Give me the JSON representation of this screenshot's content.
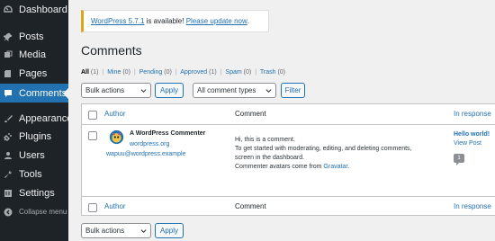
{
  "sidebar": {
    "items": [
      {
        "label": "Dashboard",
        "icon": "dashboard-icon"
      },
      {
        "label": "Posts",
        "icon": "pin-icon"
      },
      {
        "label": "Media",
        "icon": "media-icon"
      },
      {
        "label": "Pages",
        "icon": "pages-icon"
      },
      {
        "label": "Comments",
        "icon": "comment-icon",
        "current": true
      },
      {
        "label": "Appearance",
        "icon": "brush-icon"
      },
      {
        "label": "Plugins",
        "icon": "plug-icon"
      },
      {
        "label": "Users",
        "icon": "user-icon"
      },
      {
        "label": "Tools",
        "icon": "wrench-icon"
      },
      {
        "label": "Settings",
        "icon": "settings-icon"
      },
      {
        "label": "Collapse menu",
        "icon": "collapse-icon"
      }
    ]
  },
  "notice": {
    "version_link": "WordPress 5.7.1",
    "middle": " is available! ",
    "update_link": "Please update now",
    "end": "."
  },
  "page_title": "Comments",
  "filters": {
    "all": "All",
    "all_count": "(1)",
    "mine": "Mine",
    "mine_count": "(0)",
    "pending": "Pending",
    "pending_count": "(0)",
    "approved": "Approved",
    "approved_count": "(1)",
    "spam": "Spam",
    "spam_count": "(0)",
    "trash": "Trash",
    "trash_count": "(0)",
    "separator": "|"
  },
  "toolbar": {
    "bulk_actions": "Bulk actions",
    "apply": "Apply",
    "comment_types": "All comment types",
    "filter": "Filter"
  },
  "table": {
    "headers": {
      "author": "Author",
      "comment": "Comment",
      "in_response": "In response"
    },
    "row": {
      "author_name": "A WordPress Commenter",
      "author_site": "wordpress.org",
      "author_email": "wapuu@wordpress.example",
      "comment_line1": "Hi, this is a comment.",
      "comment_line2": "To get started with moderating, editing, and deleting comments,",
      "comment_line3": "screen in the dashboard.",
      "comment_line4_pre": "Commenter avatars come from ",
      "comment_line4_link": "Gravatar",
      "comment_line4_post": ".",
      "response_title": "Hello world!",
      "response_view": "View Post",
      "comment_count": "1"
    }
  },
  "bottom_toolbar": {
    "bulk_actions": "Bulk actions",
    "apply": "Apply"
  },
  "colors": {
    "sidebar_bg": "#1d2327",
    "accent": "#2271b1",
    "notice_border": "#dba617",
    "page_bg": "#f0f0f1"
  }
}
